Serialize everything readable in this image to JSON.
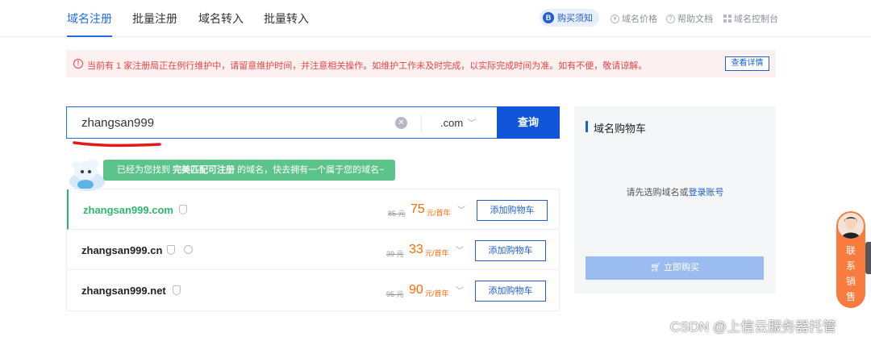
{
  "nav": {
    "tabs": [
      {
        "label": "域名注册",
        "active": true
      },
      {
        "label": "批量注册"
      },
      {
        "label": "域名转入"
      },
      {
        "label": "批量转入"
      }
    ],
    "buy_notice": "购买须知",
    "links": {
      "price": "域名价格",
      "help": "帮助文档",
      "console": "域名控制台"
    }
  },
  "alert": {
    "message": "当前有 1 家注册局正在例行维护中，请留意维护时间，并注意相关操作。如维护工作未及时完成，以实际完成时间为准。如有不便，敬请谅解。",
    "detail_button": "查看详情"
  },
  "search": {
    "value": "zhangsan999",
    "tld": ".com",
    "button": "查询"
  },
  "found_banner": {
    "prefix": "已经为您找到",
    "highlight": "完美匹配可注册",
    "suffix": "的域名，快去拥有一个属于您的域名~"
  },
  "results": [
    {
      "domain": "zhangsan999.com",
      "old_price": "85 元",
      "price": "75",
      "unit": "元/首年",
      "add": "添加购物车",
      "badges": 1
    },
    {
      "domain": "zhangsan999.cn",
      "old_price": "39 元",
      "price": "33",
      "unit": "元/首年",
      "add": "添加购物车",
      "badges": 2
    },
    {
      "domain": "zhangsan999.net",
      "old_price": "95 元",
      "price": "90",
      "unit": "元/首年",
      "add": "添加购物车",
      "badges": 1
    }
  ],
  "cart": {
    "title": "域名购物车",
    "empty_text": "请先选购域名或",
    "login_link": "登录账号",
    "buy_button": "立即购买"
  },
  "contact": {
    "label_lines": [
      "联",
      "系",
      "销",
      "售"
    ]
  },
  "watermark": "CSDN @上信云服务器托管",
  "colors": {
    "accent": "#1f5fcf",
    "green": "#2fb66e",
    "price": "#ff6a00",
    "alert": "#e84545"
  }
}
